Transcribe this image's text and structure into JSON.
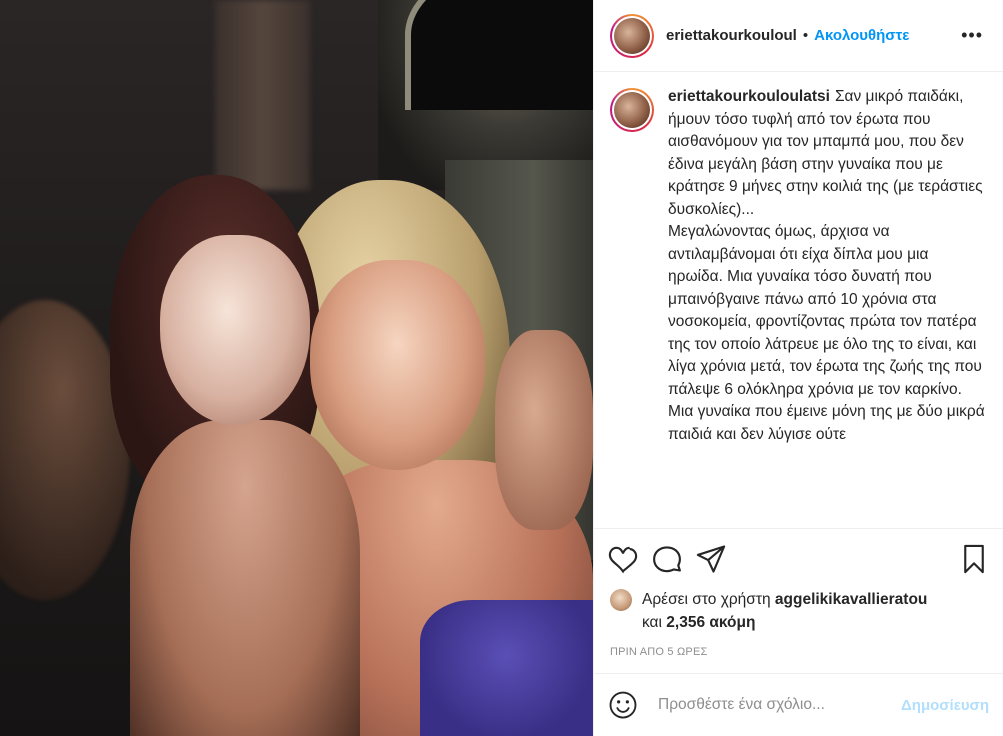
{
  "header": {
    "username": "eriettakourkouloul",
    "separator": "•",
    "follow_label": "Ακολουθήστε",
    "more_label": "•••"
  },
  "caption": {
    "username": "eriettakourkouloulatsi",
    "paragraphs": [
      "Σαν μικρό παιδάκι, ήμουν τόσο τυφλή από τον έρωτα που αισθανόμουν για τον μπαμπά μου, που δεν έδινα μεγάλη βάση στην γυναίκα που με κράτησε 9 μήνες στην κοιλιά της (με τεράστιες δυσκολίες)...",
      "Μεγαλώνοντας όμως, άρχισα να αντιλαμβάνομαι ότι είχα δίπλα μου μια ηρωίδα. Μια γυναίκα τόσο δυνατή που μπαινόβγαινε πάνω από 10 χρόνια στα νοσοκομεία, φροντίζοντας πρώτα τον πατέρα της τον οποίο λάτρευε με όλο της το είναι, και λίγα χρόνια μετά, τον έρωτα της ζωής της που πάλεψε 6 ολόκληρα χρόνια με τον καρκίνο. Μια γυναίκα που έμεινε μόνη της με δύο μικρά παιδιά και δεν λύγισε ούτε"
    ]
  },
  "likes": {
    "prefix": "Αρέσει στο χρήστη",
    "liked_by": "aggelikikavallieratou",
    "and_label": "και",
    "others_count": "2,356 ακόμη"
  },
  "timestamp": "ΠΡΙΝ ΑΠΟ 5 ΩΡΕΣ",
  "comment": {
    "placeholder": "Προσθέστε ένα σχόλιο...",
    "publish_label": "Δημοσίευση"
  },
  "icons": {
    "like": "heart-icon",
    "comment": "comment-icon",
    "share": "share-icon",
    "save": "bookmark-icon",
    "emoji": "emoji-icon"
  },
  "colors": {
    "link_blue": "#0095f6",
    "publish_disabled": "#b2dffc",
    "muted": "#8e8e8e"
  }
}
